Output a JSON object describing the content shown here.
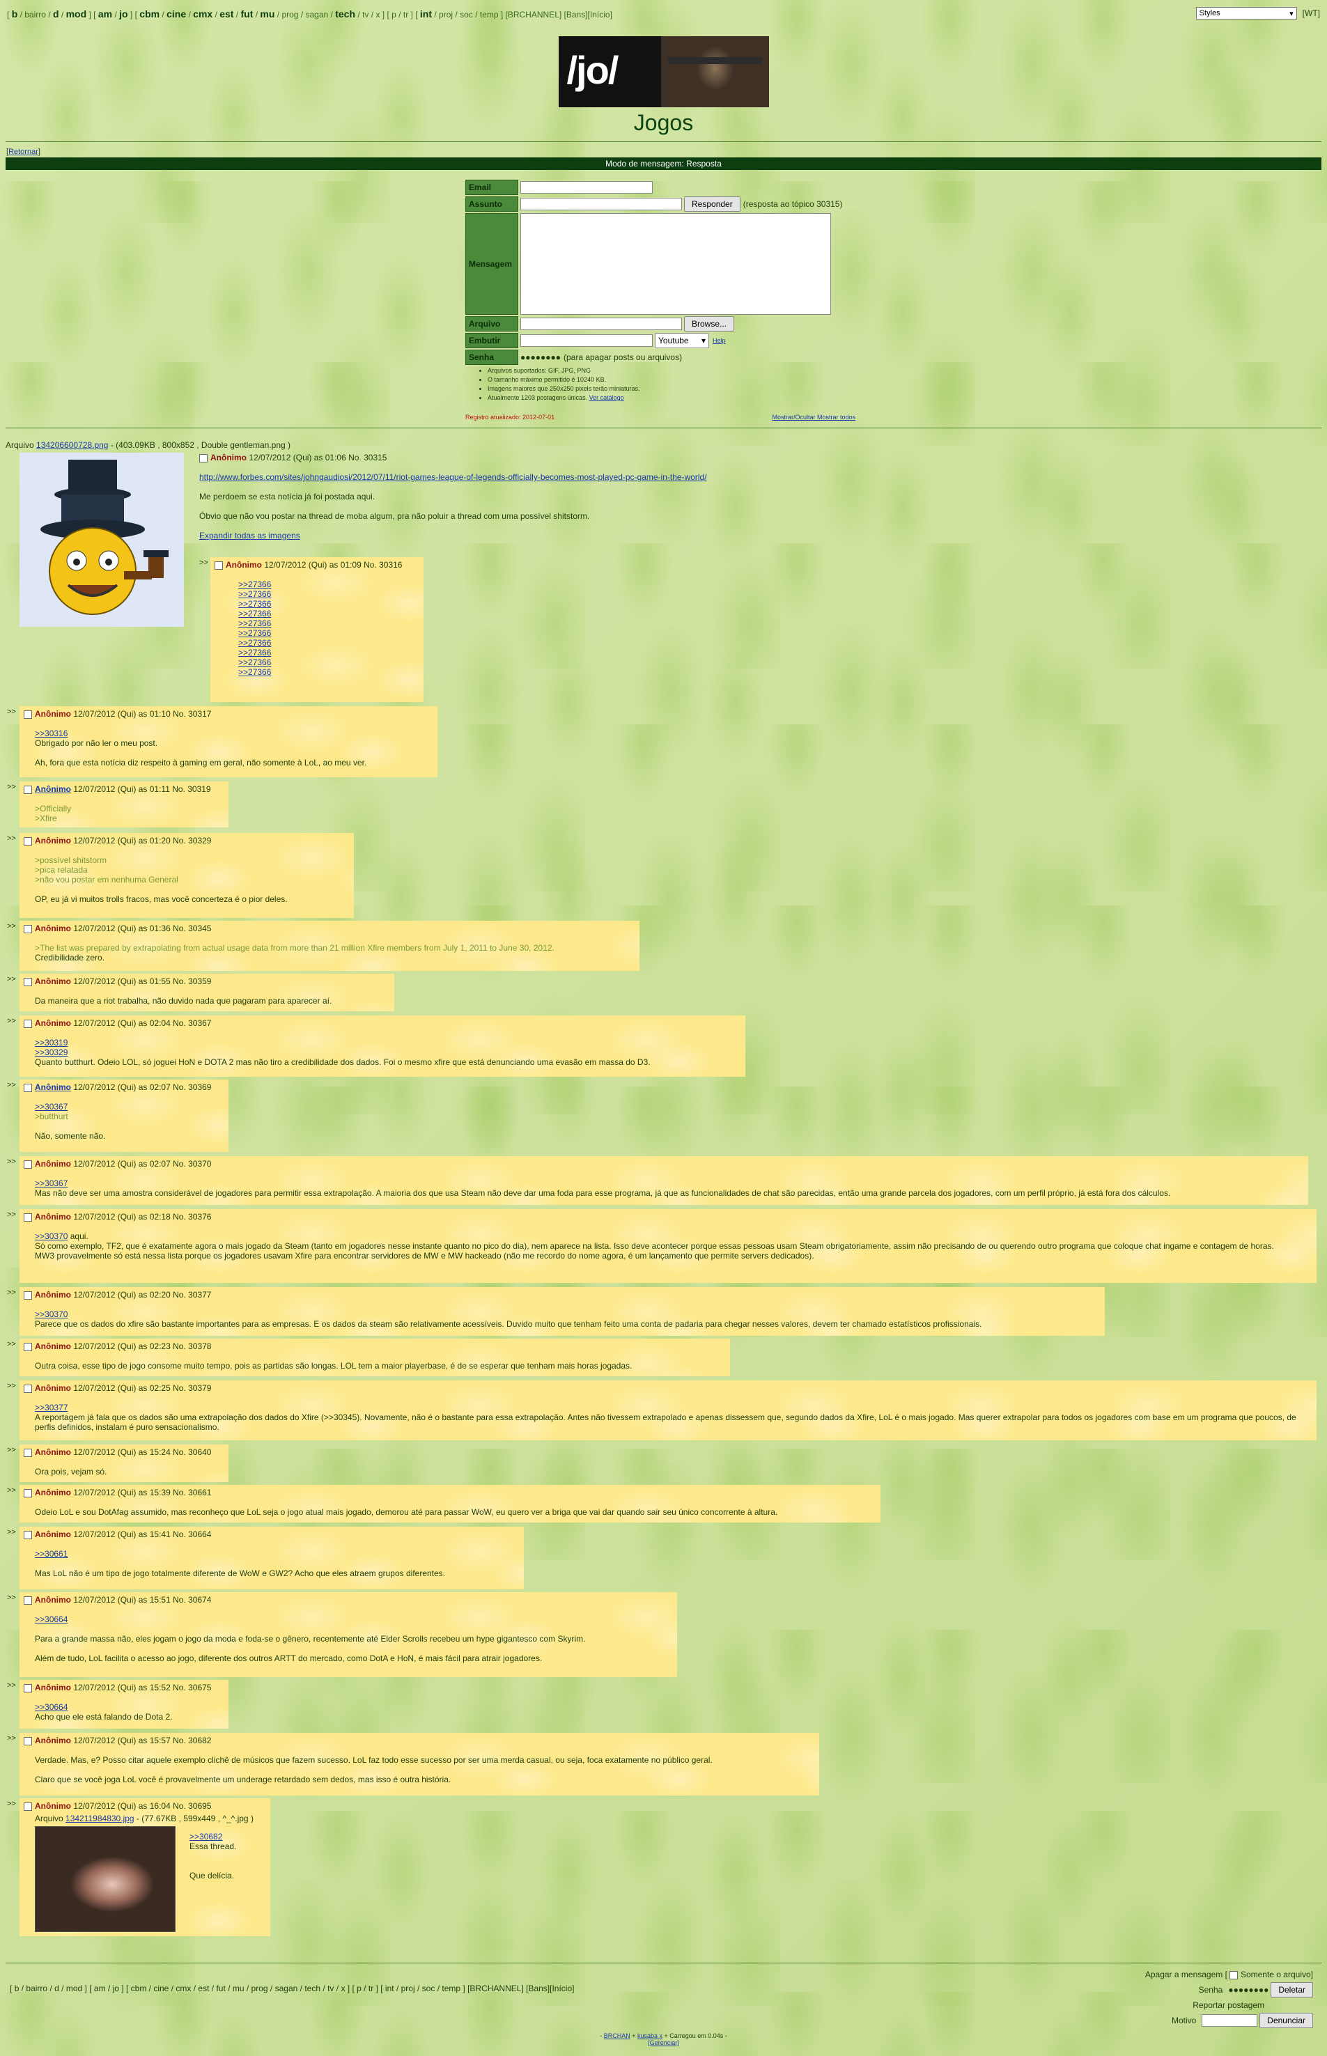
{
  "nav": {
    "items": [
      {
        "t": "[",
        "b": false,
        "s": true
      },
      {
        "t": "b",
        "b": true
      },
      {
        "t": "/",
        "s": true
      },
      {
        "t": "bairro",
        "s": true
      },
      {
        "t": "/",
        "s": true
      },
      {
        "t": "d",
        "b": true
      },
      {
        "t": "/",
        "s": true
      },
      {
        "t": "mod",
        "b": true
      },
      {
        "t": "] [",
        "s": true
      },
      {
        "t": "am",
        "b": true
      },
      {
        "t": "/",
        "s": true
      },
      {
        "t": "jo",
        "b": true
      },
      {
        "t": "] [",
        "s": true
      },
      {
        "t": "cbm",
        "b": true
      },
      {
        "t": "/",
        "s": true
      },
      {
        "t": "cine",
        "b": true
      },
      {
        "t": "/",
        "s": true
      },
      {
        "t": "cmx",
        "b": true
      },
      {
        "t": "/",
        "s": true
      },
      {
        "t": "est",
        "b": true
      },
      {
        "t": "/",
        "s": true
      },
      {
        "t": "fut",
        "b": true
      },
      {
        "t": "/",
        "s": true
      },
      {
        "t": "mu",
        "b": true
      },
      {
        "t": "/",
        "s": true
      },
      {
        "t": "prog",
        "s": true
      },
      {
        "t": "/",
        "s": true
      },
      {
        "t": "sagan",
        "s": true
      },
      {
        "t": "/",
        "s": true
      },
      {
        "t": "tech",
        "b": true
      },
      {
        "t": "/",
        "s": true
      },
      {
        "t": "tv",
        "s": true
      },
      {
        "t": "/",
        "s": true
      },
      {
        "t": "x",
        "s": true
      },
      {
        "t": "] [",
        "s": true
      },
      {
        "t": "p",
        "s": true
      },
      {
        "t": "/",
        "s": true
      },
      {
        "t": "tr",
        "s": true
      },
      {
        "t": "] [",
        "s": true
      },
      {
        "t": "int",
        "b": true
      },
      {
        "t": "/",
        "s": true
      },
      {
        "t": "proj",
        "s": true
      },
      {
        "t": "/",
        "s": true
      },
      {
        "t": "soc",
        "s": true
      },
      {
        "t": "/",
        "s": true
      },
      {
        "t": "temp",
        "s": true
      },
      {
        "t": "] [BRCHANNEL] [Bans][Início]",
        "s": true
      }
    ],
    "styles_label": "Styles",
    "wt": "[WT]"
  },
  "header": {
    "logo_text": "/jo/",
    "title": "Jogos"
  },
  "return_link": "Retornar",
  "mode": "Modo de mensagem: Resposta",
  "form": {
    "email": "Email",
    "assunto": "Assunto",
    "mensagem": "Mensagem",
    "arquivo": "Arquivo",
    "embutir": "Embutir",
    "senha": "Senha",
    "responder": "Responder",
    "topic_note": "(resposta ao tópico 30315)",
    "browse": "Browse...",
    "youtube": "Youtube",
    "help": "Help",
    "senha_val": "●●●●●●●●",
    "senha_note": "(para apagar posts ou arquivos)",
    "info": [
      "Arquivos suportados: GIF, JPG, PNG",
      "O tamanho máximo permitido é 10240 KB.",
      "Imagens maiores que 250x250 pixels terão miniaturas.",
      "Atualmente 1203 postagens únicas."
    ],
    "catalog": "Ver catálogo",
    "updated": "Registro atualizado: 2012-07-01",
    "toggle": "Mostrar/Ocultar Mostrar todos"
  },
  "op": {
    "file_label": "Arquivo",
    "file_link": "134206600728.png",
    "file_meta": "- (403.09KB , 800x852 , Double gentleman.png )",
    "name": "Anônimo",
    "date": "12/07/2012 (Qui) as 01:06 No. 30315",
    "url": "http://www.forbes.com/sites/johngaudiosi/2012/07/11/riot-games-league-of-legends-officially-becomes-most-played-pc-game-in-the-world/",
    "l1": "Me perdoem se esta notícia já foi postada aqui.",
    "l2": "Óbvio que não vou postar na thread de moba algum, pra não poluir a thread com uma possível shitstorm.",
    "expand": "Expandir todas as imagens"
  },
  "posts": [
    {
      "name": "Anônimo",
      "date": "12/07/2012 (Qui) as 01:09 No. 30316",
      "lines": [
        [
          "q",
          ">>27366"
        ],
        [
          "q",
          ">>27366"
        ],
        [
          "q",
          ">>27366"
        ],
        [
          "q",
          ">>27366"
        ],
        [
          "q",
          ">>27366"
        ],
        [
          "q",
          ">>27366"
        ],
        [
          "q",
          ">>27366"
        ],
        [
          "q",
          ">>27366"
        ],
        [
          "q",
          ">>27366"
        ],
        [
          "q",
          ">>27366"
        ]
      ]
    },
    {
      "name": "Anônimo",
      "date": "12/07/2012 (Qui) as 01:10 No. 30317",
      "lines": [
        [
          "q",
          ">>30316"
        ],
        [
          "t",
          "Obrigado por não ler o meu post."
        ],
        [
          "b",
          ""
        ],
        [
          "t",
          "Ah, fora que esta notícia diz respeito à gaming em geral, não somente à LoL, ao meu ver."
        ]
      ]
    },
    {
      "name": "Anônimo",
      "date": "12/07/2012 (Qui) as 01:11 No. 30319",
      "link": true,
      "lines": [
        [
          "g",
          ">Officially"
        ],
        [
          "g",
          ">Xfire"
        ]
      ]
    },
    {
      "name": "Anônimo",
      "date": "12/07/2012 (Qui) as 01:20 No. 30329",
      "lines": [
        [
          "g",
          ">possível shitstorm"
        ],
        [
          "g",
          ">pica relatada"
        ],
        [
          "g",
          ">não vou postar em nenhuma General"
        ],
        [
          "b",
          ""
        ],
        [
          "t",
          "OP, eu já vi muitos trolls fracos, mas você concerteza é o pior deles."
        ]
      ]
    },
    {
      "name": "Anônimo",
      "date": "12/07/2012 (Qui) as 01:36 No. 30345",
      "lines": [
        [
          "g",
          ">The list was prepared by extrapolating from actual usage data from more than 21 million Xfire members from July 1, 2011 to June 30, 2012."
        ],
        [
          "t",
          "Credibilidade zero."
        ]
      ]
    },
    {
      "name": "Anônimo",
      "date": "12/07/2012 (Qui) as 01:55 No. 30359",
      "lines": [
        [
          "t",
          "Da maneira que a riot trabalha, não duvido nada que pagaram para aparecer aí."
        ]
      ]
    },
    {
      "name": "Anônimo",
      "date": "12/07/2012 (Qui) as 02:04 No. 30367",
      "lines": [
        [
          "q",
          ">>30319"
        ],
        [
          "q",
          ">>30329"
        ],
        [
          "t",
          "Quanto butthurt. Odeio LOL, só joguei HoN e DOTA 2 mas não tiro a credibilidade dos dados. Foi o mesmo xfire que está denunciando uma evasão em massa do D3."
        ]
      ]
    },
    {
      "name": "Anônimo",
      "date": "12/07/2012 (Qui) as 02:07 No. 30369",
      "link": true,
      "lines": [
        [
          "q",
          ">>30367"
        ],
        [
          "g",
          ">butthurt"
        ],
        [
          "b",
          ""
        ],
        [
          "t",
          "Não, somente não."
        ]
      ]
    },
    {
      "name": "Anônimo",
      "date": "12/07/2012 (Qui) as 02:07 No. 30370",
      "lines": [
        [
          "q",
          ">>30367"
        ],
        [
          "t",
          "Mas não deve ser uma amostra considerável de jogadores para permitir essa extrapolação. A maioria dos que usa Steam não deve dar uma foda para esse programa, já que as funcionalidades de chat são parecidas, então uma grande parcela dos jogadores, com um perfil próprio, já está fora dos cálculos."
        ]
      ]
    },
    {
      "name": "Anônimo",
      "date": "12/07/2012 (Qui) as 02:18 No. 30376",
      "lines": [
        [
          "qt",
          ">>30370",
          " aqui."
        ],
        [
          "t",
          "Só como exemplo, TF2, que é exatamente agora o mais jogado da Steam (tanto em jogadores nesse instante quanto no pico do dia), nem aparece na lista. Isso deve acontecer porque essas pessoas usam Steam obrigatoriamente, assim não precisando de ou querendo outro programa que coloque chat ingame e contagem de horas."
        ],
        [
          "t",
          "MW3 provavelmente só está nessa lista porque os jogadores usavam Xfire para encontrar servidores de MW e MW hackeado (não me recordo do nome agora, é um lançamento que permite servers dedicados)."
        ]
      ]
    },
    {
      "name": "Anônimo",
      "date": "12/07/2012 (Qui) as 02:20 No. 30377",
      "lines": [
        [
          "q",
          ">>30370"
        ],
        [
          "t",
          "Parece que os dados do xfire são bastante importantes para as empresas. E os dados da steam são relativamente acessíveis. Duvido muito que tenham feito uma conta de padaria para chegar nesses valores, devem ter chamado estatísticos profissionais."
        ]
      ]
    },
    {
      "name": "Anônimo",
      "date": "12/07/2012 (Qui) as 02:23 No. 30378",
      "lines": [
        [
          "t",
          "Outra coisa, esse tipo de jogo consome muito tempo, pois as partidas são longas. LOL tem a maior playerbase, é de se esperar que tenham mais horas jogadas."
        ]
      ]
    },
    {
      "name": "Anônimo",
      "date": "12/07/2012 (Qui) as 02:25 No. 30379",
      "lines": [
        [
          "q",
          ">>30377"
        ],
        [
          "t",
          "A reportagem já fala que os dados são uma extrapolação dos dados do Xfire (>>30345). Novamente, não é o bastante para essa extrapolação. Antes não tivessem extrapolado e apenas dissessem que, segundo dados da Xfire, LoL é o mais jogado. Mas querer extrapolar para todos os jogadores com base em um programa que poucos, de perfis definidos, instalam é puro sensacionalismo."
        ]
      ]
    },
    {
      "name": "Anônimo",
      "date": "12/07/2012 (Qui) as 15:24 No. 30640",
      "lines": [
        [
          "t",
          "Ora pois, vejam só."
        ]
      ]
    },
    {
      "name": "Anônimo",
      "date": "12/07/2012 (Qui) as 15:39 No. 30661",
      "lines": [
        [
          "t",
          "Odeio LoL e sou DotAfag assumido, mas reconheço que LoL seja o jogo atual mais jogado, demorou até para passar WoW, eu quero ver a briga que vai dar quando sair seu único concorrente à altura."
        ]
      ]
    },
    {
      "name": "Anônimo",
      "date": "12/07/2012 (Qui) as 15:41 No. 30664",
      "lines": [
        [
          "q",
          ">>30661"
        ],
        [
          "b",
          ""
        ],
        [
          "t",
          "Mas LoL não é um tipo de jogo totalmente diferente de WoW e GW2? Acho que eles atraem grupos diferentes."
        ]
      ]
    },
    {
      "name": "Anônimo",
      "date": "12/07/2012 (Qui) as 15:51 No. 30674",
      "lines": [
        [
          "q",
          ">>30664"
        ],
        [
          "b",
          ""
        ],
        [
          "t",
          "Para a grande massa não, eles jogam o jogo da moda e foda-se o gênero, recentemente até Elder Scrolls recebeu um hype gigantesco com Skyrim."
        ],
        [
          "b",
          ""
        ],
        [
          "t",
          "Além de tudo, LoL facilita o acesso ao jogo, diferente dos outros ARTT do mercado, como DotA e HoN, é mais fácil para atrair jogadores."
        ]
      ]
    },
    {
      "name": "Anônimo",
      "date": "12/07/2012 (Qui) as 15:52 No. 30675",
      "lines": [
        [
          "q",
          ">>30664"
        ],
        [
          "t",
          "Acho que ele está falando de Dota 2."
        ]
      ]
    },
    {
      "name": "Anônimo",
      "date": "12/07/2012 (Qui) as 15:57 No. 30682",
      "lines": [
        [
          "t",
          "Verdade. Mas, e? Posso citar aquele exemplo clichê de músicos que fazem sucesso. LoL faz todo esse sucesso por ser uma merda casual, ou seja, foca exatamente no público geral."
        ],
        [
          "b",
          ""
        ],
        [
          "t",
          "Claro que se você joga LoL você é provavelmente um underage retardado sem dedos, mas isso é outra história."
        ]
      ]
    },
    {
      "name": "Anônimo",
      "date": "12/07/2012 (Qui) as 16:04 No. 30695",
      "file": {
        "label": "Arquivo",
        "link": "134211984830.jpg",
        "meta": "- (77.67KB , 599x449 , ^_^.jpg )"
      },
      "lines": [
        [
          "q",
          ">>30682"
        ],
        [
          "t",
          "Essa thread."
        ],
        [
          "b",
          ""
        ],
        [
          "b",
          ""
        ],
        [
          "t",
          "Que delícia."
        ]
      ]
    }
  ],
  "bottom": {
    "apagar": "Apagar a mensagem [",
    "somente": "Somente o arquivo]",
    "senha": "Senha",
    "senha_val": "●●●●●●●●",
    "deletar": "Deletar",
    "reportar": "Reportar postagem",
    "motivo": "Motivo",
    "denunciar": "Denunciar"
  },
  "footer": {
    "l1a": "- ",
    "brchan": "BRCHAN",
    "plus": " + ",
    "kusaba": "kusaba x",
    "l1b": " + Carregou em 0.04s -",
    "gerenciar": "[Gerenciar]"
  }
}
